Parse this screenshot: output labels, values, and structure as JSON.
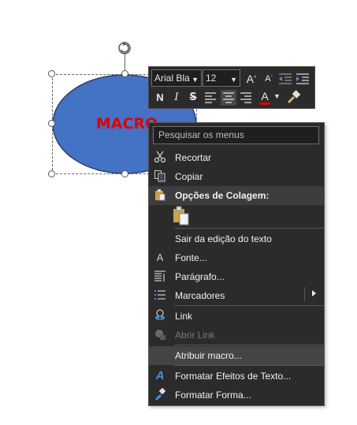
{
  "shape": {
    "text": "MACRO"
  },
  "mini_toolbar": {
    "font_name": "Arial Bla",
    "font_size": "12",
    "grow_font": "A",
    "shrink_font": "A",
    "bold": "N",
    "italic": "I",
    "font_color_letter": "A"
  },
  "menu": {
    "search_placeholder": "Pesquisar os menus",
    "items": [
      {
        "label": "Recortar"
      },
      {
        "label": "Copiar"
      },
      {
        "label": "Opções de Colagem:"
      },
      {
        "label": "Sair da edição do texto"
      },
      {
        "label": "Fonte..."
      },
      {
        "label": "Parágrafo..."
      },
      {
        "label": "Marcadores"
      },
      {
        "label": "Link"
      },
      {
        "label": "Abrir Link"
      },
      {
        "label": "Atribuir macro..."
      },
      {
        "label": "Formatar Efeitos de Texto..."
      },
      {
        "label": "Formatar Forma..."
      }
    ]
  },
  "colors": {
    "shape_fill": "#4472c4",
    "shape_text": "#e00000",
    "menu_bg": "#2b2b2b"
  }
}
